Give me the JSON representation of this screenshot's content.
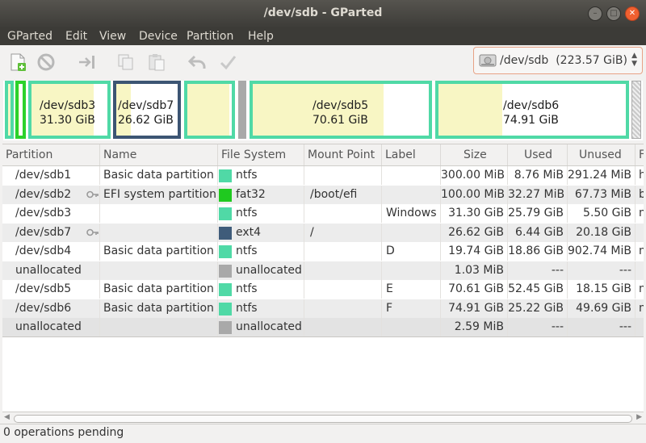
{
  "window": {
    "title": "/dev/sdb - GParted"
  },
  "menu": [
    "GParted",
    "Edit",
    "View",
    "Device",
    "Partition",
    "Help"
  ],
  "device": {
    "label": "/dev/sdb",
    "size": "(223.57 GiB)"
  },
  "diskmap": [
    {
      "name": "",
      "size": "",
      "used_fraction": 0.9,
      "color": "#50d9a6"
    },
    {
      "name": "",
      "size": "",
      "used_fraction": 0.3,
      "color": "#2bd22b"
    },
    {
      "name": "/dev/sdb3",
      "size": "31.30 GiB",
      "used_fraction": 0.82,
      "color": "#50d9a6"
    },
    {
      "name": "/dev/sdb7",
      "size": "26.62 GiB",
      "used_fraction": 0.24,
      "color": "#3c5573"
    },
    {
      "name": "",
      "size": "",
      "used_fraction": 0.95,
      "color": "#50d9a6"
    },
    {
      "name": "",
      "size": "",
      "used_fraction": 1.0,
      "color": "#a9a9a9"
    },
    {
      "name": "/dev/sdb5",
      "size": "70.61 GiB",
      "used_fraction": 0.74,
      "color": "#50d9a6"
    },
    {
      "name": "/dev/sdb6",
      "size": "74.91 GiB",
      "used_fraction": 0.34,
      "color": "#50d9a6"
    }
  ],
  "columns": [
    "Partition",
    "Name",
    "File System",
    "Mount Point",
    "Label",
    "Size",
    "Used",
    "Unused",
    "Flags"
  ],
  "rows": [
    {
      "partition": "/dev/sdb1",
      "name": "Basic data partition",
      "fs": "ntfs",
      "fs_color": "#50d9a6",
      "mount": "",
      "label": "",
      "size": "300.00 MiB",
      "used": "8.76 MiB",
      "unused": "291.24 MiB",
      "flags": "hidden",
      "key": false
    },
    {
      "partition": "/dev/sdb2",
      "name": "EFI system partition",
      "fs": "fat32",
      "fs_color": "#1fc91f",
      "mount": "/boot/efi",
      "label": "",
      "size": "100.00 MiB",
      "used": "32.27 MiB",
      "unused": "67.73 MiB",
      "flags": "boot",
      "key": true
    },
    {
      "partition": "/dev/sdb3",
      "name": "",
      "fs": "ntfs",
      "fs_color": "#50d9a6",
      "mount": "",
      "label": "Windows",
      "size": "31.30 GiB",
      "used": "25.79 GiB",
      "unused": "5.50 GiB",
      "flags": "msftdata",
      "key": false
    },
    {
      "partition": "/dev/sdb7",
      "name": "",
      "fs": "ext4",
      "fs_color": "#3f5c7a",
      "mount": "/",
      "label": "",
      "size": "26.62 GiB",
      "used": "6.44 GiB",
      "unused": "20.18 GiB",
      "flags": "",
      "key": true
    },
    {
      "partition": "/dev/sdb4",
      "name": "Basic data partition",
      "fs": "ntfs",
      "fs_color": "#50d9a6",
      "mount": "",
      "label": "D",
      "size": "19.74 GiB",
      "used": "18.86 GiB",
      "unused": "902.74 MiB",
      "flags": "msftdata",
      "key": false
    },
    {
      "partition": "unallocated",
      "name": "",
      "fs": "unallocated",
      "fs_color": "#a9a9a9",
      "mount": "",
      "label": "",
      "size": "1.03 MiB",
      "used": "---",
      "unused": "---",
      "flags": "",
      "key": false
    },
    {
      "partition": "/dev/sdb5",
      "name": "Basic data partition",
      "fs": "ntfs",
      "fs_color": "#50d9a6",
      "mount": "",
      "label": "E",
      "size": "70.61 GiB",
      "used": "52.45 GiB",
      "unused": "18.15 GiB",
      "flags": "msftdata",
      "key": false
    },
    {
      "partition": "/dev/sdb6",
      "name": "Basic data partition",
      "fs": "ntfs",
      "fs_color": "#50d9a6",
      "mount": "",
      "label": "F",
      "size": "74.91 GiB",
      "used": "25.22 GiB",
      "unused": "49.69 GiB",
      "flags": "msftdata",
      "key": false
    },
    {
      "partition": "unallocated",
      "name": "",
      "fs": "unallocated",
      "fs_color": "#a9a9a9",
      "mount": "",
      "label": "",
      "size": "2.59 MiB",
      "used": "---",
      "unused": "---",
      "flags": "",
      "key": false
    }
  ],
  "status": "0 operations pending"
}
